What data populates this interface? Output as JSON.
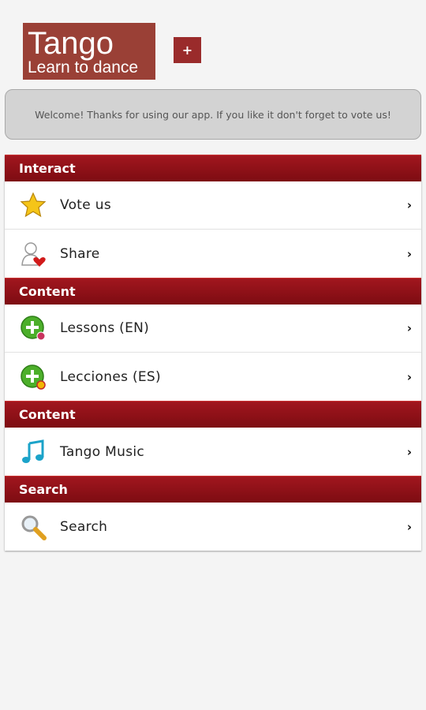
{
  "logo": {
    "title": "Tango",
    "subtitle": "Learn to dance"
  },
  "plus_button": "+",
  "welcome_text": "Welcome! Thanks for using our app. If you like it don't forget to vote us!",
  "sections": [
    {
      "header": "Interact",
      "items": [
        {
          "label": "Vote us",
          "icon": "star-icon"
        },
        {
          "label": "Share",
          "icon": "user-heart-icon"
        }
      ]
    },
    {
      "header": "Content",
      "items": [
        {
          "label": "Lessons (EN)",
          "icon": "lesson-add-icon"
        },
        {
          "label": "Lecciones (ES)",
          "icon": "lesson-add-icon"
        }
      ]
    },
    {
      "header": "Content",
      "items": [
        {
          "label": "Tango Music",
          "icon": "music-note-icon"
        }
      ]
    },
    {
      "header": "Search",
      "items": [
        {
          "label": "Search",
          "icon": "magnifier-icon"
        }
      ]
    }
  ],
  "chevron": "›",
  "colors": {
    "header_red": "#8f1118",
    "logo_bg": "#9a4036"
  }
}
